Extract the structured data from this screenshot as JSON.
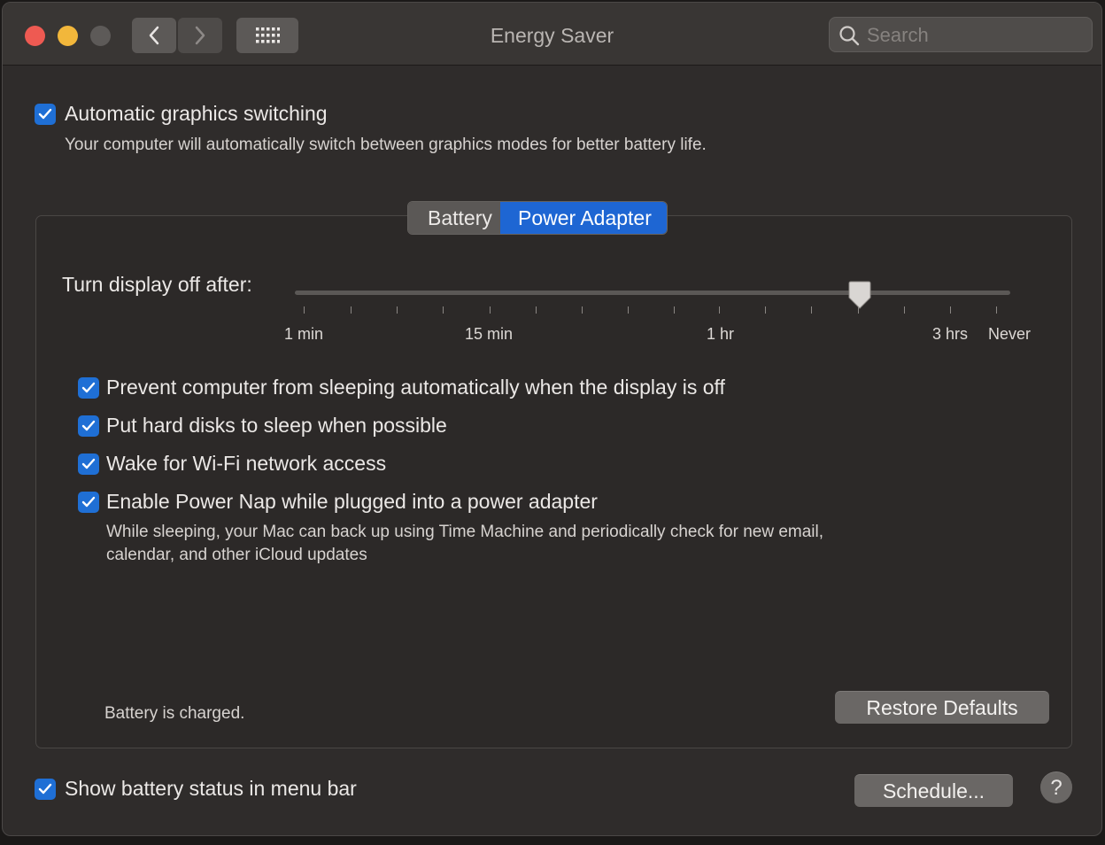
{
  "window": {
    "title": "Energy Saver"
  },
  "search": {
    "placeholder": "Search"
  },
  "graphics": {
    "label": "Automatic graphics switching",
    "description": "Your computer will automatically switch between graphics modes for better battery life.",
    "checked": true
  },
  "tabs": [
    {
      "label": "Battery",
      "selected": false
    },
    {
      "label": "Power Adapter",
      "selected": true
    }
  ],
  "display_off": {
    "label": "Turn display off after:",
    "tick_labels": [
      "1 min",
      "15 min",
      "1 hr",
      "3 hrs",
      "Never"
    ],
    "value": "1 hr 45 min"
  },
  "options": [
    {
      "label": "Prevent computer from sleeping automatically when the display is off",
      "checked": true
    },
    {
      "label": "Put hard disks to sleep when possible",
      "checked": true
    },
    {
      "label": "Wake for Wi-Fi network access",
      "checked": true
    },
    {
      "label": "Enable Power Nap while plugged into a power adapter",
      "checked": true,
      "description_line1": "While sleeping, your Mac can back up using Time Machine and periodically check for new email,",
      "description_line2": "calendar, and other iCloud updates"
    }
  ],
  "status": {
    "battery": "Battery is charged."
  },
  "buttons": {
    "restore_defaults": "Restore Defaults",
    "schedule": "Schedule...",
    "help": "?"
  },
  "menu_bar": {
    "label": "Show battery status in menu bar",
    "checked": true
  },
  "colors": {
    "accent": "#1e66d3",
    "close": "#ee5a52",
    "minimize": "#f2b73b"
  }
}
